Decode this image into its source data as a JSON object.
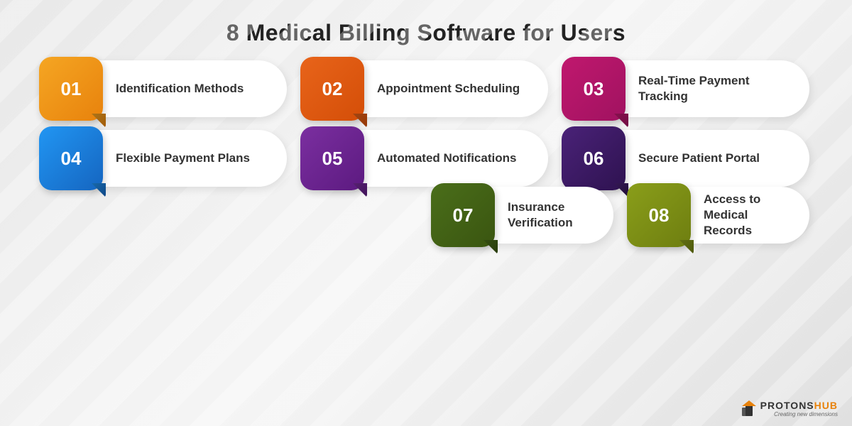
{
  "title": "8 Medical Billing Software for Users",
  "items": [
    {
      "number": "01",
      "label": "Identification Methods",
      "badgeClass": "badge-orange"
    },
    {
      "number": "02",
      "label": "Appointment Scheduling",
      "badgeClass": "badge-orange2"
    },
    {
      "number": "03",
      "label": "Real-Time Payment Tracking",
      "badgeClass": "badge-pink"
    },
    {
      "number": "04",
      "label": "Flexible Payment Plans",
      "badgeClass": "badge-blue"
    },
    {
      "number": "05",
      "label": "Automated Notifications",
      "badgeClass": "badge-purple"
    },
    {
      "number": "06",
      "label": "Secure Patient Portal",
      "badgeClass": "badge-darkpurple"
    },
    {
      "number": "07",
      "label": "Insurance Verification",
      "badgeClass": "badge-darkgreen"
    },
    {
      "number": "08",
      "label": "Access to Medical Records",
      "badgeClass": "badge-olive"
    }
  ],
  "logo": {
    "brand": "PROTONS",
    "brand2": "HUB",
    "tagline": "Creating new dimensions"
  }
}
